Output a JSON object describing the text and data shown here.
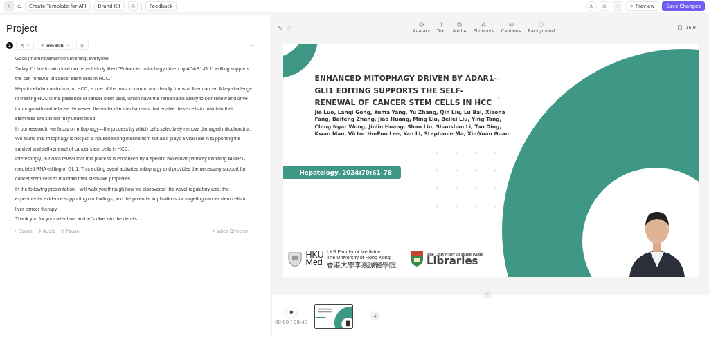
{
  "topbar": {
    "left_buttons": [
      "Create Template for API",
      "Brand Kit"
    ],
    "feedback": "Feedback",
    "preview": "Preview",
    "save": "Save Changes"
  },
  "project": {
    "title": "Project",
    "scene_number": "1",
    "voice": "medlib",
    "paragraphs": [
      "Good [morning/afternoon/evening] everyone,",
      "Today, I'd like to introduce our recent study titled \"Enhanced mitophagy driven by ADAR1-GLI1 editing supports the self-renewal of cancer stem cells in HCC.\"",
      "Hepatocellular carcinoma, or HCC, is one of the most common and deadly forms of liver cancer. A key challenge in treating HCC is the presence of cancer stem cells, which have the remarkable ability to self-renew and drive tumor growth and relapse. However, the molecular mechanisms that enable these cells to maintain their stemness are still not fully understood.",
      "In our research, we focus on mitophagy—the process by which cells selectively remove damaged mitochondria. We found that mitophagy is not just a housekeeping mechanism but also plays a vital role in supporting the survival and self-renewal of cancer stem cells in HCC.",
      "Interestingly, our data reveal that this process is enhanced by a specific molecular pathway involving ADAR1-mediated RNA editing of GLI1. This editing event activates mitophagy and provides the necessary support for cancer stem cells to maintain their stem-like properties.",
      "In the following presentation, I will walk you through how we discovered this novel regulatory axis, the experimental evidence supporting our findings, and the potential implications for targeting cancer stem cells in liver cancer therapy.",
      "Thank you for your attention, and let's dive into the details."
    ],
    "actions": [
      {
        "kind": "scene",
        "label": "Scene"
      },
      {
        "kind": "audio",
        "label": "Audio"
      },
      {
        "kind": "pause",
        "label": "Pause"
      }
    ],
    "voice_director": "Voice Director"
  },
  "toolbar": {
    "tools": [
      {
        "kind": "avatars",
        "label": "Avatars"
      },
      {
        "kind": "text",
        "label": "Text"
      },
      {
        "kind": "media",
        "label": "Media"
      },
      {
        "kind": "elements",
        "label": "Elements"
      },
      {
        "kind": "captions",
        "label": "Captions"
      },
      {
        "kind": "background",
        "label": "Background"
      }
    ],
    "ratio": "16:9"
  },
  "slide": {
    "title": "ENHANCED MITOPHAGY DRIVEN BY ADAR1-GLI1 EDITING SUPPORTS THE SELF-RENEWAL OF CANCER STEM CELLS IN HCC",
    "authors": "Jie Luo, Lanqi Gong, Yuma Yang, Yu Zhang, Qin Liu, Lu Bai, Xiaona Fang, Baifeng Zhang, Jiao Huang, Ming Liu, Beilei Liu, Ying Tang, Ching Ngar Wong, Jinlin Huang, Shan Liu, Shanshan Li, Tao Ding, Kwan Man, Victor Ho-Fun Lee, Yan Li, Stephanie Ma, Xin-Yuan Guan",
    "journal": "Hepatology. 2024;79:61–78",
    "faculty_logo": {
      "hku": "HKU",
      "med": "Med",
      "lines": [
        "LKS Faculty of Medicine",
        "The University of Hong Kong",
        "香港大學李嘉誠醫學院"
      ]
    },
    "library_logo": {
      "university": "The University of Hong Kong",
      "name": "Libraries"
    }
  },
  "timeline": {
    "time": "00:00 / 00:40"
  }
}
